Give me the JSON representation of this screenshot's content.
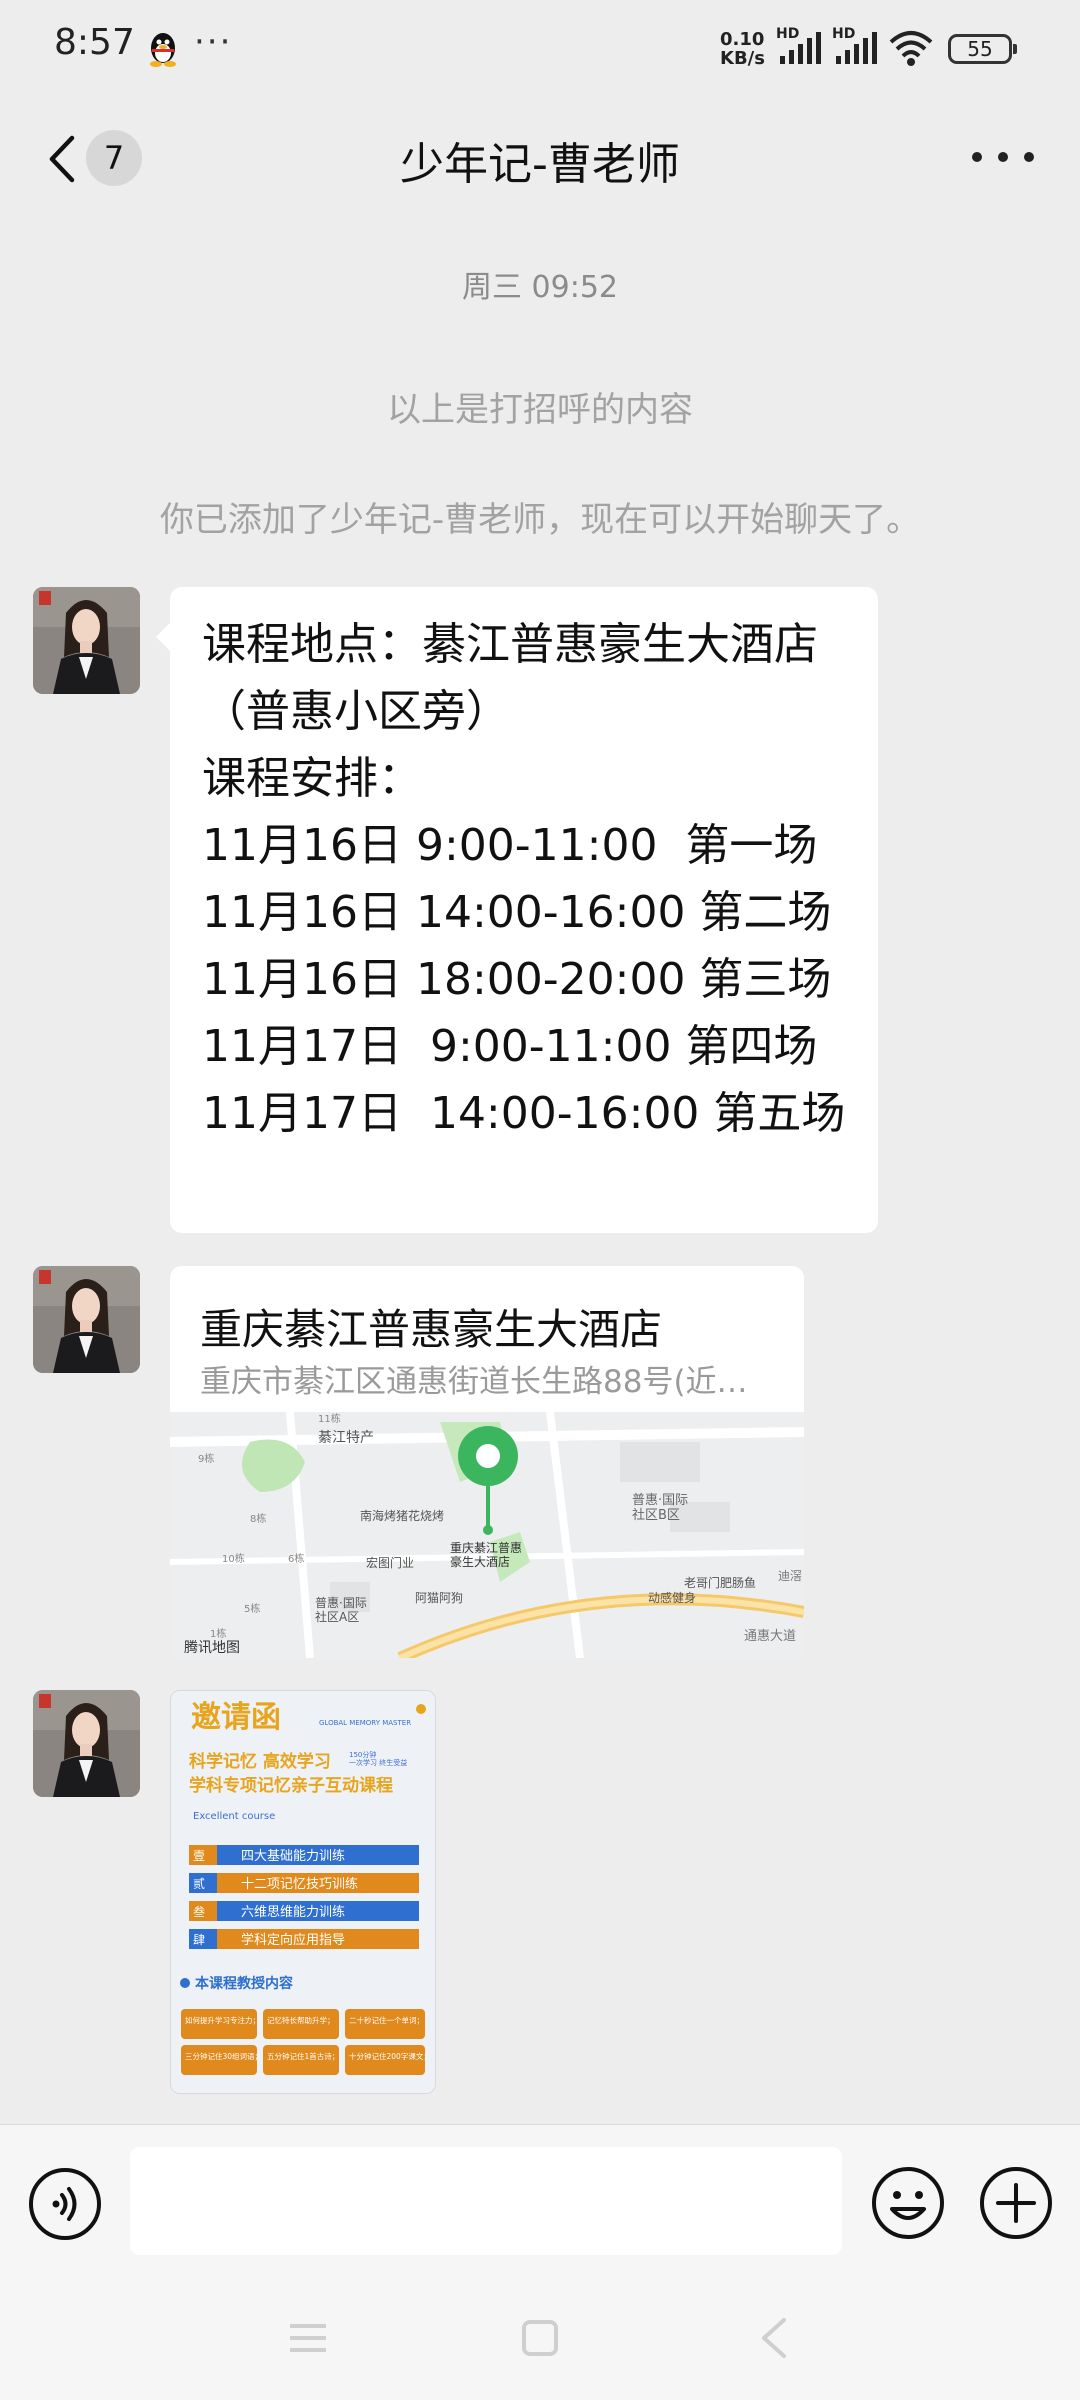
{
  "status_bar": {
    "time": "8:57",
    "more": "···",
    "net_speed_value": "0.10",
    "net_speed_unit": "KB/s",
    "signal1_label": "HD",
    "signal2_label": "HD",
    "battery": "55"
  },
  "nav": {
    "unread_count": "7",
    "title": "少年记-曹老师"
  },
  "messages": {
    "timestamp": "周三 09:52",
    "greeting_note": "以上是打招呼的内容",
    "added_note": "你已添加了少年记-曹老师，现在可以开始聊天了。",
    "text_lines": [
      "课程地点：綦江普惠豪生大酒店",
      "（普惠小区旁）",
      "",
      "课程安排：",
      "11月16日 9:00-11:00  第一场",
      "11月16日 14:00-16:00 第二场",
      "11月16日 18:00-20:00 第三场",
      "11月17日  9:00-11:00 第四场",
      "11月17日  14:00-16:00 第五场"
    ],
    "location": {
      "name": "重庆綦江普惠豪生大酒店",
      "address": "重庆市綦江区通惠街道长生路88号(近…",
      "map_labels": {
        "poi_name": "重庆綦江普惠\n豪生大酒店",
        "specialty": "綦江特产",
        "bbq": "南海烤猪花烧烤",
        "door": "宏图门业",
        "apek": "阿猫阿狗",
        "community_a": "普惠·国际\n社区A区",
        "community_b": "普惠·国际\n社区B区",
        "fish": "老哥门肥肠鱼",
        "gym": "动感健身",
        "road": "通惠大道",
        "brand": "腾讯地图",
        "b11": "11栋",
        "b9": "9栋",
        "b8": "8栋",
        "b10": "10栋",
        "b6": "6栋",
        "b5": "5栋",
        "b1": "1栋",
        "partial": "迪滘"
      }
    },
    "invitation": {
      "title": "邀请函",
      "brand": "GLOBAL MEMORY MASTER",
      "headline1": "科学记忆 高效学习",
      "headline_side": "150分钟\n一次学习 终生受益",
      "headline2": "学科专项记忆亲子互动课程",
      "course_label": "Excellent course",
      "items": [
        {
          "num": "壹",
          "text": "四大基础能力训练",
          "color": "#2f6fd0"
        },
        {
          "num": "贰",
          "text": "十二项记忆技巧训练",
          "color": "#e08a1e"
        },
        {
          "num": "叁",
          "text": "六维思维能力训练",
          "color": "#2f6fd0"
        },
        {
          "num": "肆",
          "text": "学科定向应用指导",
          "color": "#e08a1e"
        }
      ],
      "content_title": "本课程教授内容",
      "grid": [
        "如何提升学习专注力；",
        "记忆特长帮助升学；",
        "二十秒记住一个单词；",
        "三分钟记住30组词语；",
        "五分钟记住1首古诗；",
        "十分钟记住200字课文；"
      ]
    }
  },
  "input": {
    "placeholder": ""
  },
  "colors": {
    "page_bg": "#ededed",
    "bubble_bg": "#ffffff",
    "pin_green": "#3cb55f",
    "sys_text": "#a2a2a2"
  },
  "icons": [
    "qq-penguin-icon",
    "signal-icon",
    "wifi-icon",
    "battery-icon",
    "back-chevron-icon",
    "more-dots-icon",
    "voice-icon",
    "emoji-icon",
    "plus-icon",
    "location-pin-icon",
    "menu-icon",
    "home-icon",
    "back-nav-icon"
  ]
}
